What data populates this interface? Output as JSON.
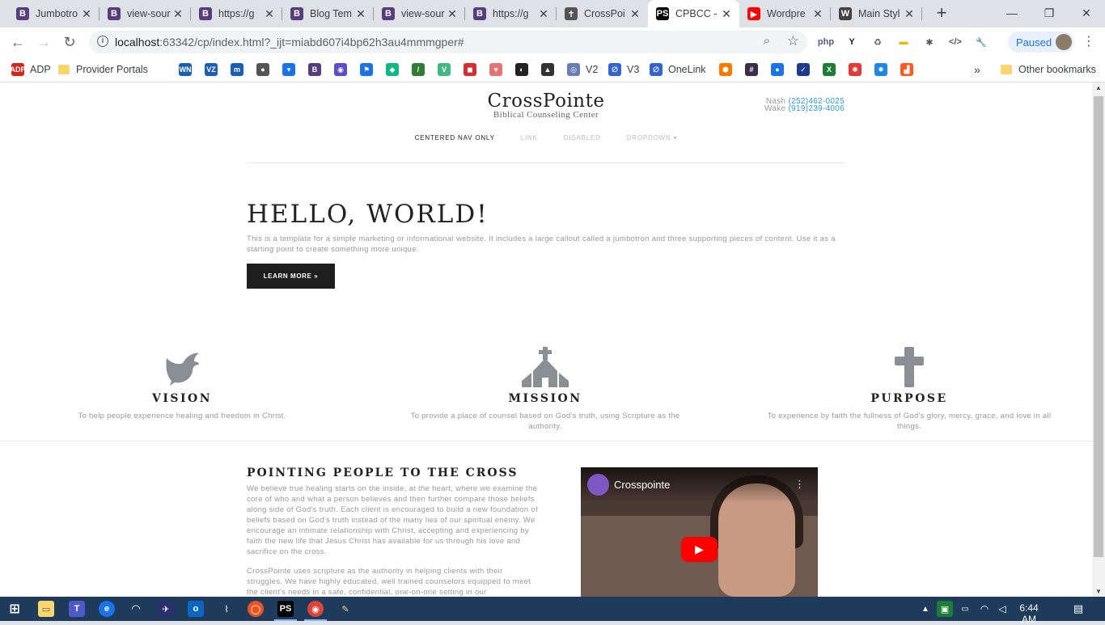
{
  "browser": {
    "tabs": [
      {
        "title": "Jumbotro",
        "favicon": "B",
        "favicon_color": "#563d7c"
      },
      {
        "title": "view-sour",
        "favicon": "B",
        "favicon_color": "#563d7c"
      },
      {
        "title": "https://g",
        "favicon": "B",
        "favicon_color": "#563d7c"
      },
      {
        "title": "Blog Tem",
        "favicon": "B",
        "favicon_color": "#563d7c"
      },
      {
        "title": "view-sour",
        "favicon": "B",
        "favicon_color": "#563d7c"
      },
      {
        "title": "https://g",
        "favicon": "B",
        "favicon_color": "#563d7c"
      },
      {
        "title": "CrossPoi",
        "favicon": "✝",
        "favicon_color": "#555555"
      },
      {
        "title": "CPBCC -",
        "favicon": "PS",
        "favicon_color": "#000000",
        "active": true
      },
      {
        "title": "Wordpre",
        "favicon": "▶",
        "favicon_color": "#ff0000"
      },
      {
        "title": "Main Styl",
        "favicon": "W",
        "favicon_color": "#464342"
      }
    ],
    "url_host": "localhost",
    "url_rest": ":63342/cp/index.html?_ijt=miabd607i4bp62h3au4mmmgper#",
    "profile_status": "Paused",
    "extensions": [
      "php",
      "Y",
      "♻",
      "▬",
      "✱",
      "</>",
      "🔧"
    ],
    "bookmarks": [
      {
        "label": "ADP",
        "icon": "ADP",
        "color": "#d0271d"
      },
      {
        "label": "Provider Portals",
        "icon": "folder",
        "color": "#f9d56e"
      },
      {
        "label": "",
        "icon": "WN",
        "color": "#1a5fb4"
      },
      {
        "label": "",
        "icon": "VZ",
        "color": "#1a5fb4"
      },
      {
        "label": "",
        "icon": "m",
        "color": "#1a5fb4"
      },
      {
        "label": "",
        "icon": "●",
        "color": "#555555"
      },
      {
        "label": "",
        "icon": "▾",
        "color": "#1a73e8"
      },
      {
        "label": "",
        "icon": "B",
        "color": "#563d7c"
      },
      {
        "label": "",
        "icon": "◉",
        "color": "#5b4ccc"
      },
      {
        "label": "",
        "icon": "⚑",
        "color": "#1a73e8"
      },
      {
        "label": "",
        "icon": "◆",
        "color": "#10b981"
      },
      {
        "label": "",
        "icon": "/",
        "color": "#2e7d32"
      },
      {
        "label": "",
        "icon": "V",
        "color": "#41b883"
      },
      {
        "label": "",
        "icon": "◼",
        "color": "#d32f2f"
      },
      {
        "label": "",
        "icon": "♥",
        "color": "#e57373"
      },
      {
        "label": "",
        "icon": "◐",
        "color": "#222222"
      },
      {
        "label": "",
        "icon": "▲",
        "color": "#333333"
      },
      {
        "label": "V2",
        "icon": "◎",
        "color": "#6a7db3"
      },
      {
        "label": "V3",
        "icon": "∅",
        "color": "#3366cc"
      },
      {
        "label": "OneLink",
        "icon": "∅",
        "color": "#3366cc"
      },
      {
        "label": "",
        "icon": "⬢",
        "color": "#f57c00"
      },
      {
        "label": "",
        "icon": "#",
        "color": "#3c2e4a"
      },
      {
        "label": "",
        "icon": "●",
        "color": "#1a73e8"
      },
      {
        "label": "",
        "icon": "✓",
        "color": "#1e3a8a"
      },
      {
        "label": "",
        "icon": "X",
        "color": "#1d7d36"
      },
      {
        "label": "",
        "icon": "✱",
        "color": "#e53935"
      },
      {
        "label": "",
        "icon": "✸",
        "color": "#1e88e5"
      },
      {
        "label": "",
        "icon": "▟",
        "color": "#ff5722"
      }
    ],
    "overflow": "»",
    "other_bookmarks": "Other bookmarks"
  },
  "site": {
    "brand_name": "CrossPointe",
    "brand_sub": "Biblical Counseling Center",
    "phone_nash_label": "Nash",
    "phone_nash": "(252)462-0025",
    "phone_wake_label": "Wake",
    "phone_wake": "(919)239-4006",
    "nav": [
      "CENTERED NAV ONLY",
      "LINK",
      "DISABLED",
      "DROPDOWN ▾"
    ],
    "jumbotron": {
      "title": "HELLO, WORLD!",
      "text": "This is a template for a simple marketing or informational website. It includes a large callout called a jumbotron and three supporting pieces of content. Use it as a starting point to create something more unique.",
      "button": "LEARN MORE »"
    },
    "features": [
      {
        "title": "VISION",
        "text": "To help people experience healing and freedom in Christ.",
        "icon": "dove-icon"
      },
      {
        "title": "MISSION",
        "text": "To provide a place of counsel based on God's truth, using Scripture as the authority.",
        "icon": "church-icon"
      },
      {
        "title": "PURPOSE",
        "text": "To experience by faith the fullness of God's glory, mercy, grace, and love in all things.",
        "icon": "cross-icon"
      }
    ],
    "cross_section": {
      "title": "POINTING PEOPLE TO THE CROSS",
      "p1": "We believe true healing starts on the inside, at the heart, where we examine the core of who and what a person believes and then further compare those beliefs along side of God's truth. Each client is encouraged to build a new foundation of beliefs based on God's truth instead of the many lies of our spiritual enemy. We encourage an intimate relationship with Christ, accepting and experiencing by faith the new life that Jesus Christ has available for us through his love and sacrifice on the cross.",
      "p2": "CrossPointe uses scripture as the authority in helping clients with their struggles. We have highly educated, well trained counselors equipped to meet the client's needs in a safe, confidential, one-on-one setting in our"
    },
    "video": {
      "channel": "Crosspointe"
    }
  },
  "taskbar": {
    "time": "6:44 AM"
  }
}
